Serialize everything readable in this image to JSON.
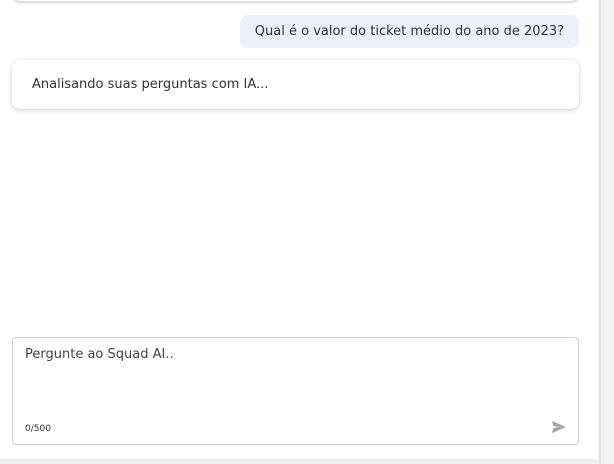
{
  "chat": {
    "messages": [
      {
        "role": "user",
        "text": "Qual é o valor do ticket médio do ano de 2023?"
      },
      {
        "role": "assistant",
        "text": "Analisando suas perguntas com IA..."
      }
    ]
  },
  "input": {
    "placeholder": "Pergunte ao Squad AI..",
    "value": "",
    "counter": "0/500",
    "send_icon": "send-icon"
  }
}
